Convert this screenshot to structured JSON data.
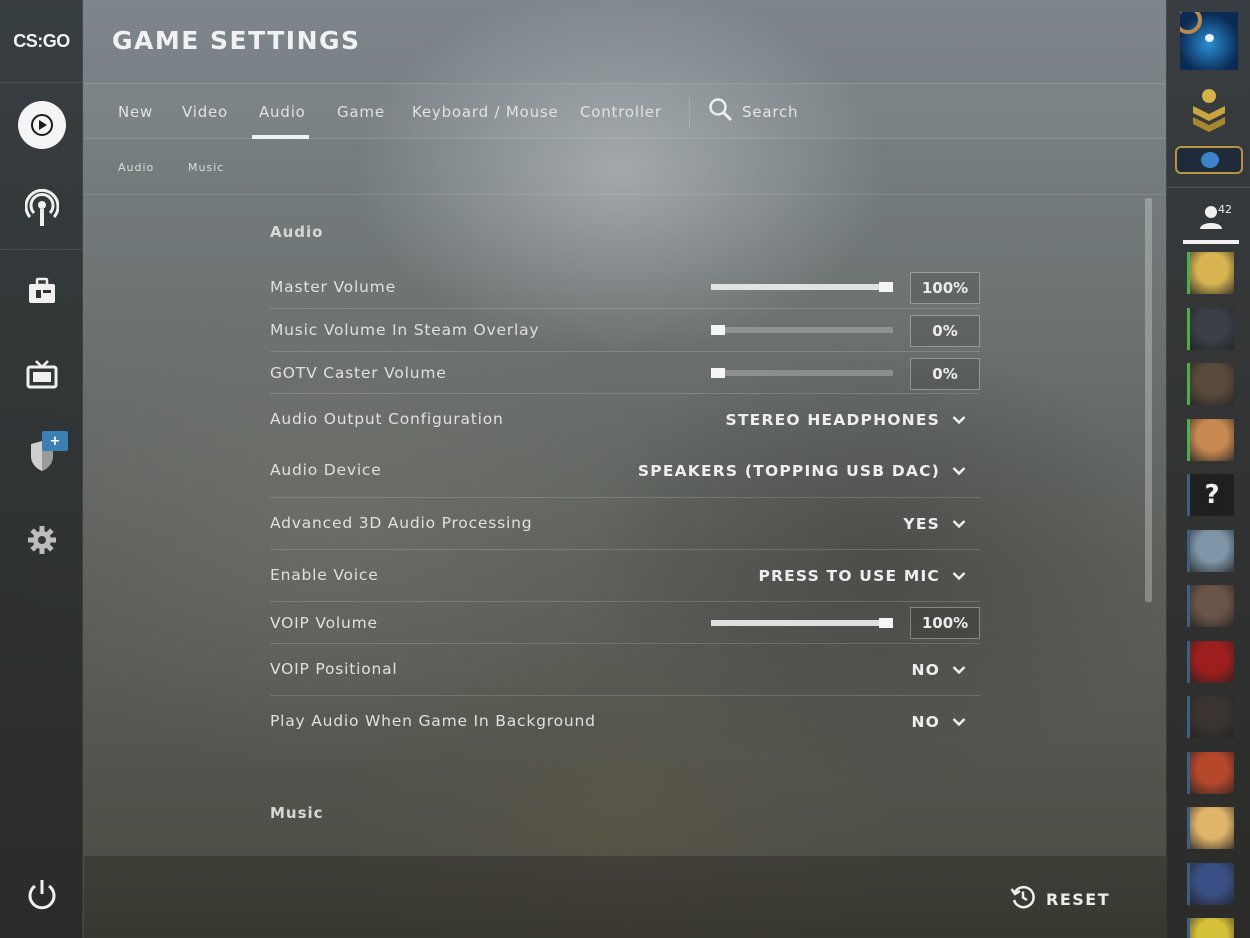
{
  "app": {
    "logo_text": "CS:GO",
    "title": "GAME SETTINGS"
  },
  "left_nav": {
    "items": [
      {
        "id": "play",
        "icon": "play-icon"
      },
      {
        "id": "watch",
        "icon": "broadcast-icon"
      },
      {
        "id": "inventory",
        "icon": "briefcase-icon"
      },
      {
        "id": "tv",
        "icon": "tv-icon"
      },
      {
        "id": "operations",
        "icon": "shield-icon",
        "badge": "+"
      },
      {
        "id": "settings",
        "icon": "gear-icon"
      }
    ],
    "power_icon": "power-icon"
  },
  "tabs": [
    {
      "label": "New",
      "active": false
    },
    {
      "label": "Video",
      "active": false
    },
    {
      "label": "Audio",
      "active": true
    },
    {
      "label": "Game",
      "active": false
    },
    {
      "label": "Keyboard / Mouse",
      "active": false
    },
    {
      "label": "Controller",
      "active": false
    }
  ],
  "search": {
    "label": "Search",
    "icon": "search-icon"
  },
  "subtabs": [
    {
      "label": "Audio"
    },
    {
      "label": "Music"
    }
  ],
  "sections": {
    "audio": "Audio",
    "music": "Music"
  },
  "settings": [
    {
      "label": "Master Volume",
      "type": "slider",
      "value": 1.0,
      "display": "100%"
    },
    {
      "label": "Music Volume In Steam Overlay",
      "type": "slider",
      "value": 0.0,
      "display": "0%"
    },
    {
      "label": "GOTV Caster Volume",
      "type": "slider",
      "value": 0.0,
      "display": "0%"
    },
    {
      "label": "Audio Output Configuration",
      "type": "dropdown",
      "display": "STEREO HEADPHONES"
    },
    {
      "label": "Audio Device",
      "type": "dropdown",
      "display": "SPEAKERS (TOPPING USB DAC)"
    },
    {
      "label": "Advanced 3D Audio Processing",
      "type": "dropdown",
      "display": "YES"
    },
    {
      "label": "Enable Voice",
      "type": "dropdown",
      "display": "PRESS TO USE MIC"
    },
    {
      "label": "VOIP Volume",
      "type": "slider",
      "value": 1.0,
      "display": "100%"
    },
    {
      "label": "VOIP Positional",
      "type": "dropdown",
      "display": "NO"
    },
    {
      "label": "Play Audio When Game In Background",
      "type": "dropdown",
      "display": "NO"
    }
  ],
  "footer": {
    "reset_label": "RESET",
    "reset_icon": "history-reset-icon"
  },
  "right_bar": {
    "friends_count": "42",
    "friend_avatar_colors": [
      "#d8b552",
      "#3a3f48",
      "#5a4a3c",
      "#c98a52",
      "#1f1f1f",
      "#7f96a8",
      "#6a5448",
      "#9e1e1e",
      "#3a3430",
      "#b5472b",
      "#e0b46a",
      "#3a4f86",
      "#d6c23a"
    ],
    "accent": "#4bb04b"
  }
}
